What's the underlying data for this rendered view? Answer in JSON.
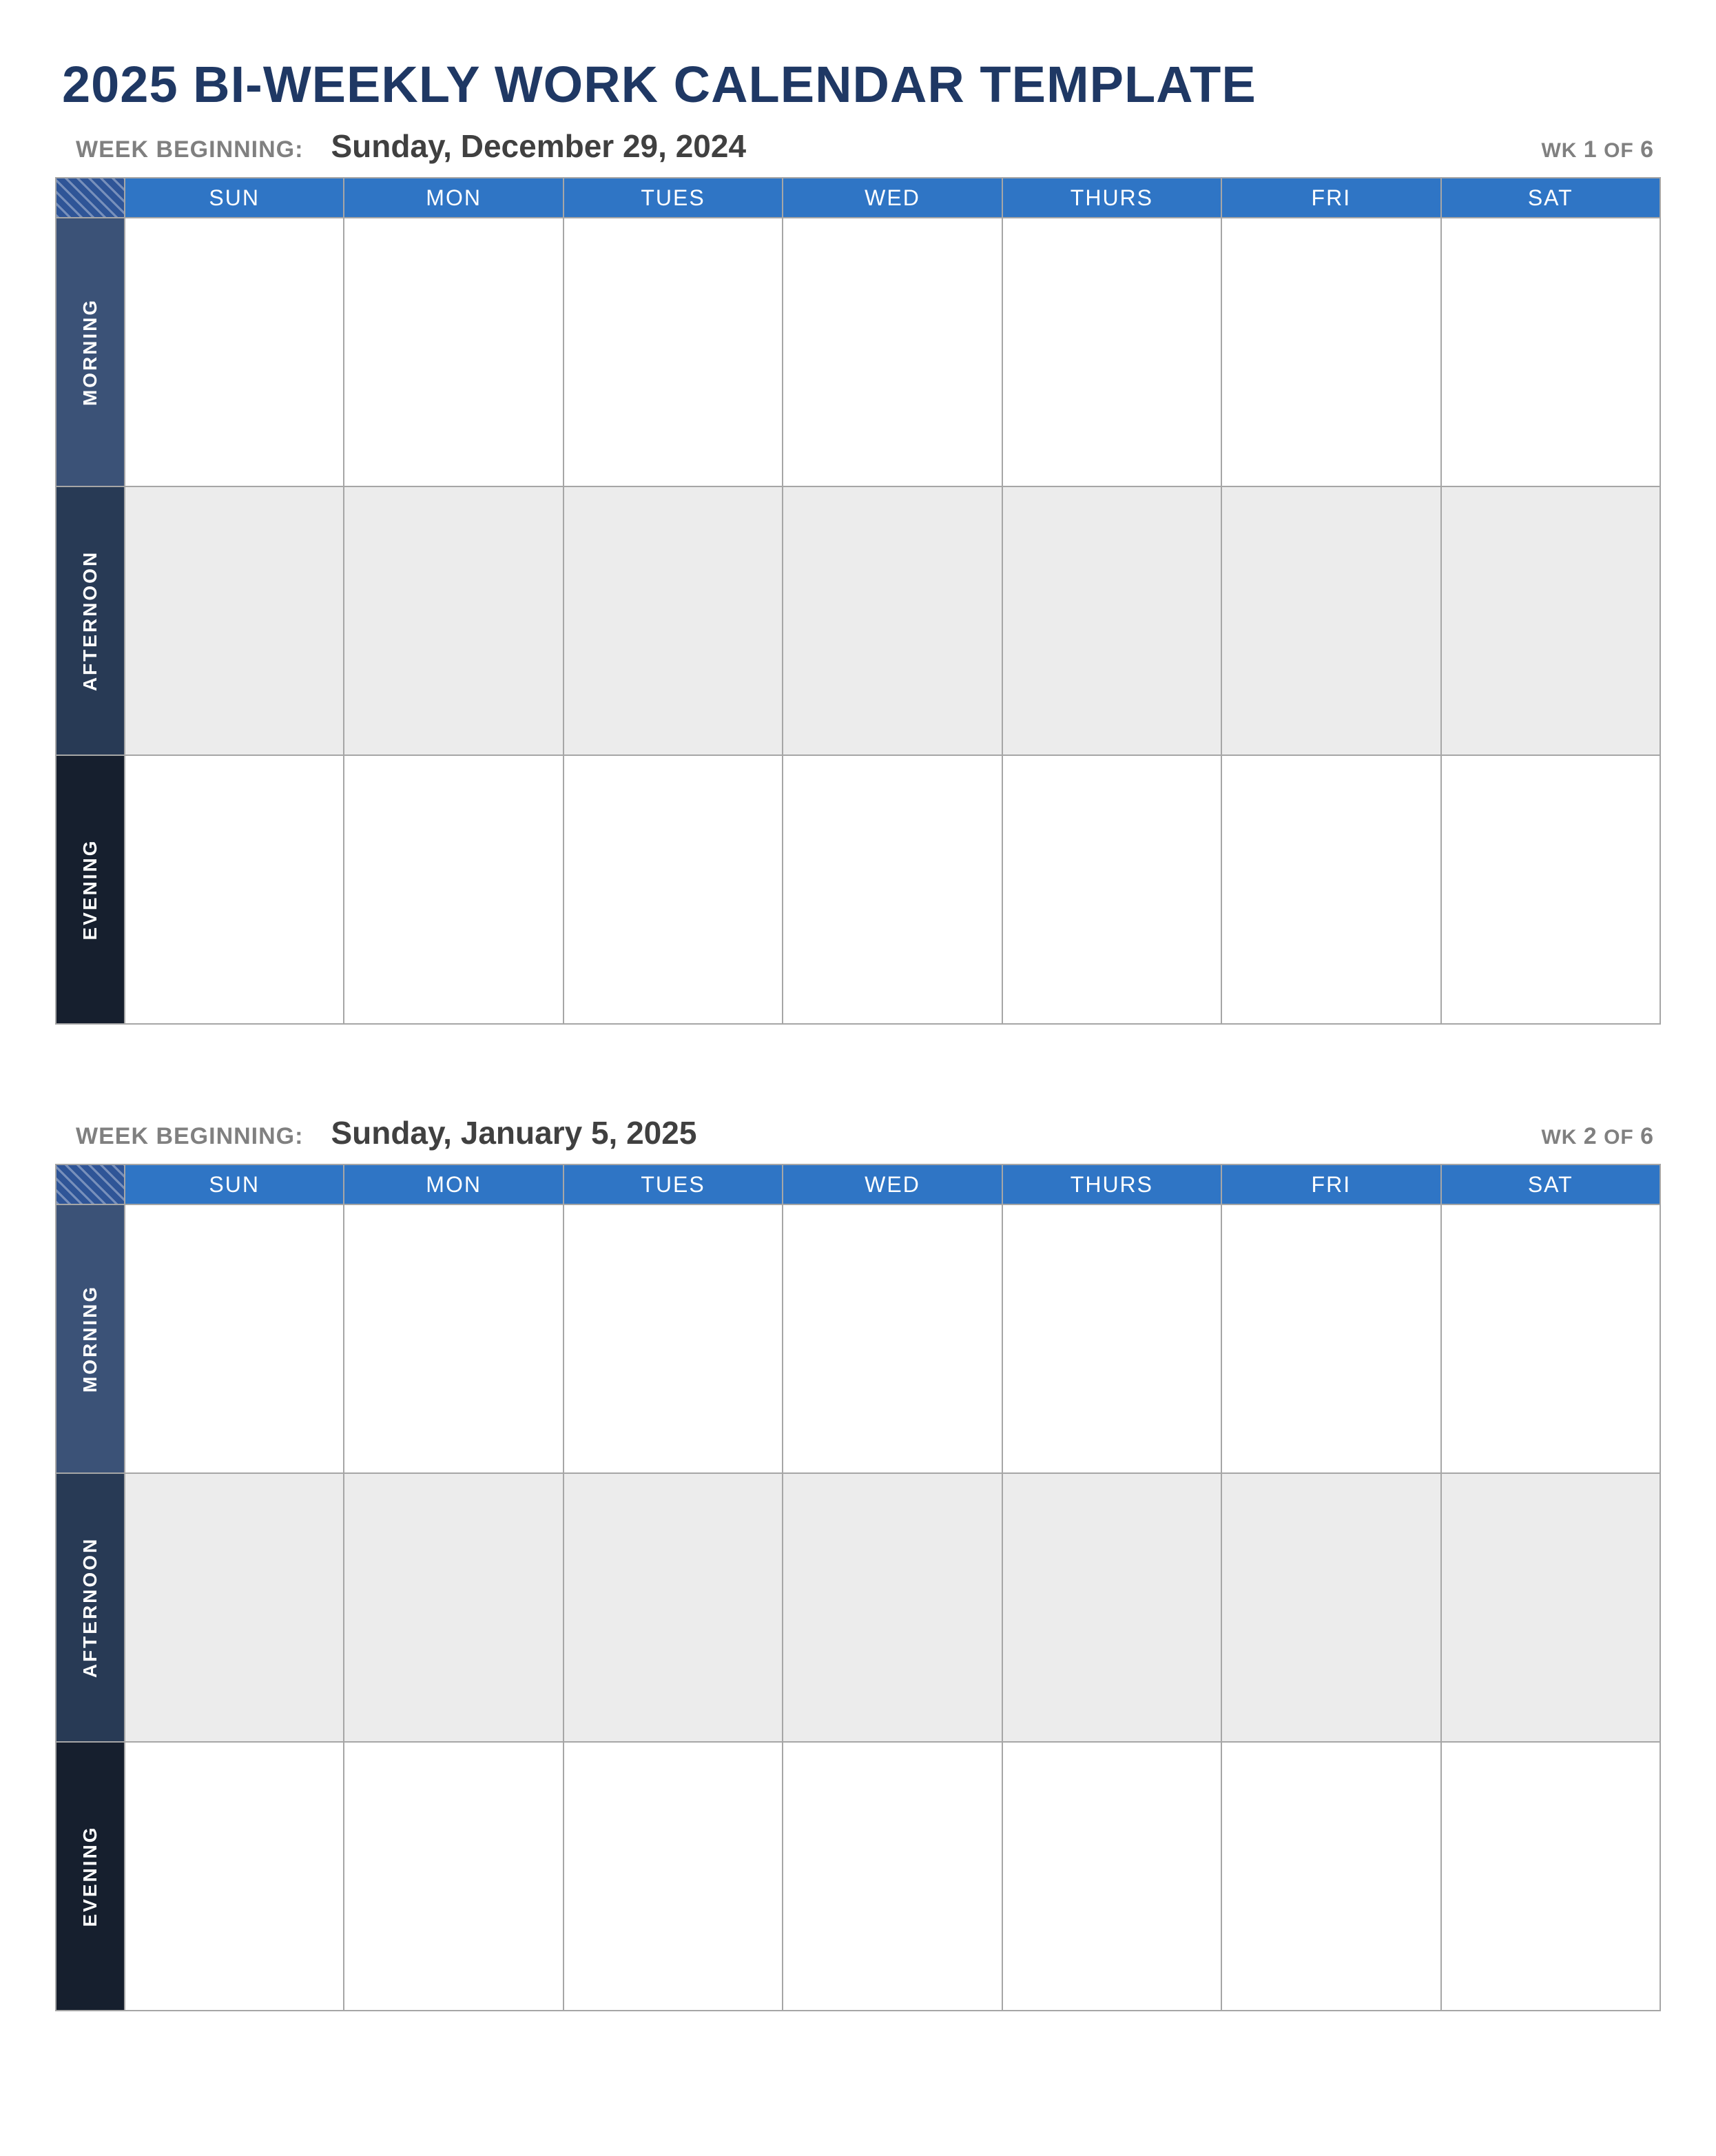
{
  "title": "2025 BI-WEEKLY WORK CALENDAR TEMPLATE",
  "week_beginning_label": "WEEK BEGINNING:",
  "day_headers": [
    "SUN",
    "MON",
    "TUES",
    "WED",
    "THURS",
    "FRI",
    "SAT"
  ],
  "row_labels": {
    "morning": "MORNING",
    "afternoon": "AFTERNOON",
    "evening": "EVENING"
  },
  "weeks": [
    {
      "date": "Sunday, December 29, 2024",
      "counter_prefix": "WK",
      "counter_num": "1",
      "counter_of": "OF",
      "counter_total": "6"
    },
    {
      "date": "Sunday, January 5, 2025",
      "counter_prefix": "WK",
      "counter_num": "2",
      "counter_of": "OF",
      "counter_total": "6"
    }
  ]
}
